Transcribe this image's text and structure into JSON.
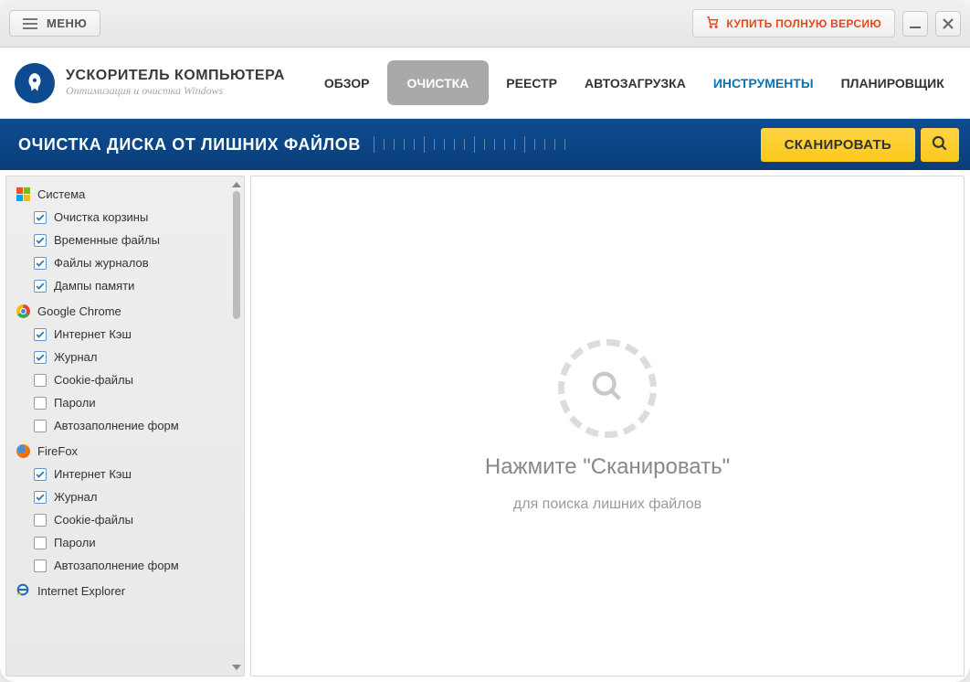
{
  "titlebar": {
    "menu_label": "МЕНЮ",
    "buy_label": "КУПИТЬ ПОЛНУЮ ВЕРСИЮ"
  },
  "header": {
    "app_title": "УСКОРИТЕЛЬ КОМПЬЮТЕРА",
    "app_subtitle": "Оптимизация и очистка Windows",
    "nav": {
      "overview": "ОБЗОР",
      "cleanup": "ОЧИСТКА",
      "registry": "РЕЕСТР",
      "startup": "АВТОЗАГРУЗКА",
      "tools": "ИНСТРУМЕНТЫ",
      "scheduler": "ПЛАНИРОВЩИК"
    }
  },
  "section": {
    "title": "ОЧИСТКА ДИСКА ОТ ЛИШНИХ ФАЙЛОВ",
    "scan_label": "СКАНИРОВАТЬ"
  },
  "sidebar": {
    "groups": [
      {
        "name": "Система",
        "icon": "windows",
        "items": [
          {
            "label": "Очистка корзины",
            "checked": true
          },
          {
            "label": "Временные файлы",
            "checked": true
          },
          {
            "label": "Файлы журналов",
            "checked": true
          },
          {
            "label": "Дампы памяти",
            "checked": true
          }
        ]
      },
      {
        "name": "Google Chrome",
        "icon": "chrome",
        "items": [
          {
            "label": "Интернет Кэш",
            "checked": true
          },
          {
            "label": "Журнал",
            "checked": true
          },
          {
            "label": "Cookie-файлы",
            "checked": false
          },
          {
            "label": "Пароли",
            "checked": false
          },
          {
            "label": "Автозаполнение форм",
            "checked": false
          }
        ]
      },
      {
        "name": "FireFox",
        "icon": "firefox",
        "items": [
          {
            "label": "Интернет Кэш",
            "checked": true
          },
          {
            "label": "Журнал",
            "checked": true
          },
          {
            "label": "Cookie-файлы",
            "checked": false
          },
          {
            "label": "Пароли",
            "checked": false
          },
          {
            "label": "Автозаполнение форм",
            "checked": false
          }
        ]
      },
      {
        "name": "Internet Explorer",
        "icon": "ie",
        "items": []
      }
    ]
  },
  "main": {
    "placeholder_line1": "Нажмите \"Сканировать\"",
    "placeholder_line2": "для поиска лишних файлов"
  }
}
